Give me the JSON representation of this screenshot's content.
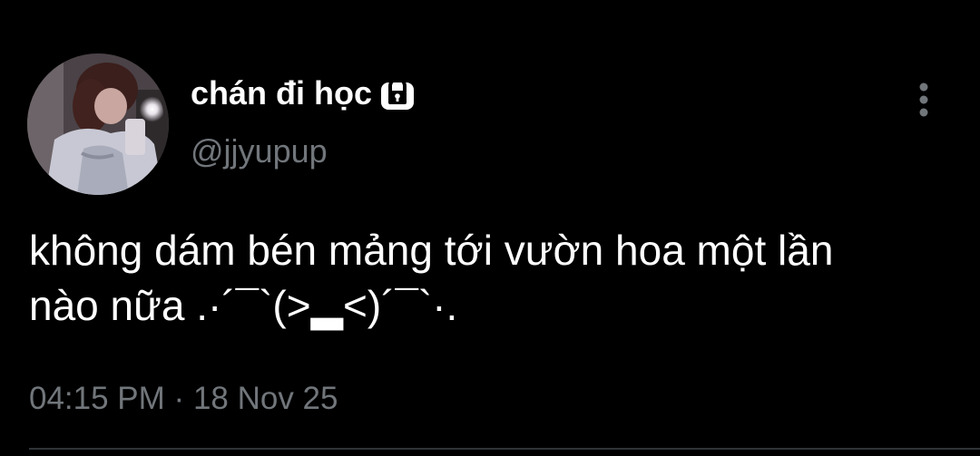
{
  "tweet": {
    "author": {
      "display_name": "chán đi học",
      "handle": "@jjyupup",
      "avatar_icon": "profile-photo",
      "protected_icon": "lock-icon"
    },
    "text_lines": [
      "không dám bén mảng tới vườn hoa một lần",
      "nào nữa .·´¯`(>▂<)´¯`·."
    ],
    "time": "04:15 PM",
    "separator": "·",
    "date": "18 Nov 25",
    "more_icon": "more-vertical-icon"
  },
  "colors": {
    "background": "#000000",
    "primary_text": "#ffffff",
    "secondary_text": "#71767b",
    "divider": "#2f3336"
  }
}
